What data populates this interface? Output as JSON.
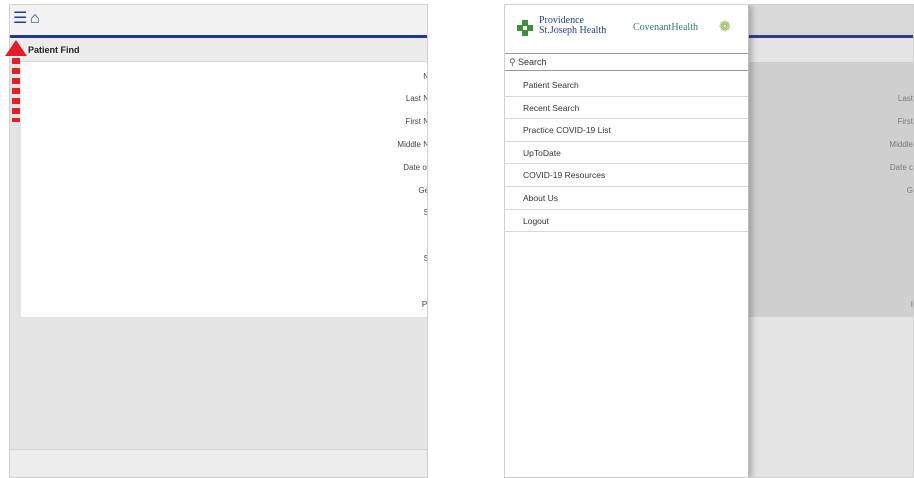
{
  "left_panel": {
    "icons": {
      "menu": "hamburger-menu-icon",
      "home": "home-icon"
    },
    "page_title": "Patient Find",
    "labels": [
      "N",
      "Last N",
      "First N",
      "Middle N",
      "Date of",
      "Ge",
      "S",
      "S",
      "Pl"
    ]
  },
  "right_panel": {
    "brand": {
      "logo1_line1": "Providence",
      "logo1_line2": "St.Joseph Health",
      "logo2": "CovenantHealth"
    },
    "search": {
      "placeholder": "Search",
      "icon": "search-icon"
    },
    "menu": [
      "Patient Search",
      "Recent Search",
      "Practice COVID-19 List",
      "UpToDate",
      "COVID-19 Resources",
      "About Us",
      "Logout"
    ],
    "background_labels": [
      "Last",
      "First",
      "Middle",
      "Date c",
      "G",
      "I"
    ]
  },
  "colors": {
    "nav_blue": "#1f3a8f",
    "annotation_red": "#e31e24",
    "providence_green": "#3e8e3a",
    "covenant_teal": "#2f7a74"
  }
}
